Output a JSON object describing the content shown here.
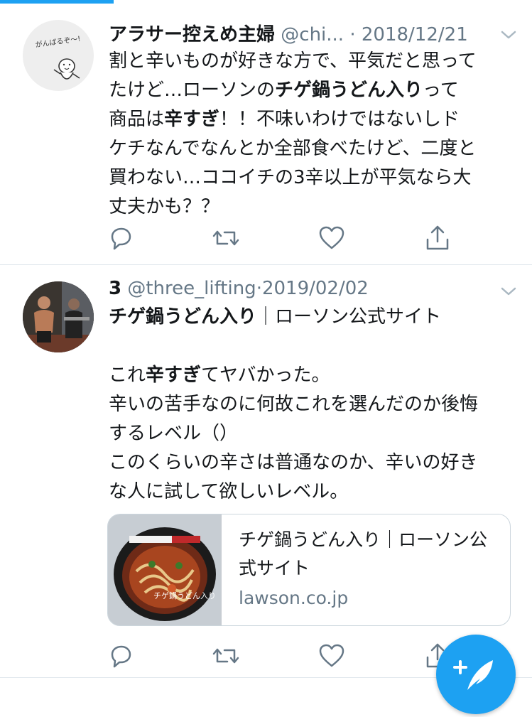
{
  "tweets": [
    {
      "name": "アラサー控えめ主婦",
      "handle": "@chi...",
      "sep": "·",
      "date": "2018/12/21",
      "avatar_text": "がんばるぞ〜!",
      "lines": [
        [
          {
            "t": "割と辛いものが好きな方で、平気だと思って",
            "b": false
          }
        ],
        [
          {
            "t": "たけど…ローソンの",
            "b": false
          },
          {
            "t": "チゲ鍋うどん入り",
            "b": true
          },
          {
            "t": "って",
            "b": false
          }
        ],
        [
          {
            "t": "商品は",
            "b": false
          },
          {
            "t": "辛すぎ",
            "b": true
          },
          {
            "t": "！！不味いわけではないしド",
            "b": false
          }
        ],
        [
          {
            "t": "ケチなんでなんとか全部食べたけど、二度と",
            "b": false
          }
        ],
        [
          {
            "t": "買わない…ココイチの3辛以上が平気なら大",
            "b": false
          }
        ],
        [
          {
            "t": "丈夫かも？？",
            "b": false
          }
        ]
      ]
    },
    {
      "name": "3",
      "handle": "@three_lifting",
      "sep": "·",
      "date": "2019/02/02",
      "lines": [
        [
          {
            "t": "チゲ鍋うどん入り",
            "b": true
          },
          {
            "t": "｜ローソン公式サイト",
            "b": false
          }
        ],
        [
          {
            "t": "",
            "b": false
          }
        ],
        [
          {
            "t": "これ",
            "b": false
          },
          {
            "t": "辛すぎ",
            "b": true
          },
          {
            "t": "てヤバかった。",
            "b": false
          }
        ],
        [
          {
            "t": "辛いの苦手なのに何故これを選んだのか後悔",
            "b": false
          }
        ],
        [
          {
            "t": "するレベル（）",
            "b": false
          }
        ],
        [
          {
            "t": "このくらいの辛さは普通なのか、辛いの好き",
            "b": false
          }
        ],
        [
          {
            "t": "な人に試して欲しいレベル。",
            "b": false
          }
        ]
      ],
      "card": {
        "title": "チゲ鍋うどん入り｜ローソン公式サイト",
        "domain": "lawson.co.jp",
        "image_text": "チゲ鍋うどん入り"
      }
    }
  ],
  "icons": [
    "reply-icon",
    "retweet-icon",
    "like-icon",
    "share-icon",
    "chevron-down-icon",
    "compose-tweet-icon"
  ],
  "colors": {
    "accent": "#1da1f2",
    "muted": "#657786",
    "text": "#14171a",
    "border": "#e1e8ed"
  }
}
